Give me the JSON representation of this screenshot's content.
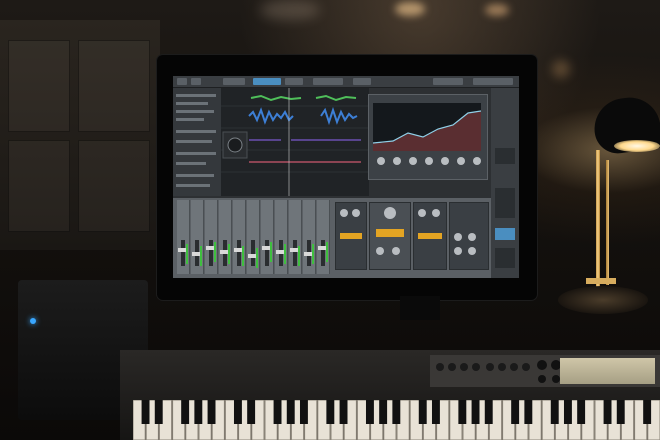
{
  "scene": {
    "description_tag": "studio-desk",
    "colors": {
      "wall": "#14110e",
      "lamp_light": "#ffd98c",
      "screen_bg": "#2d3033",
      "waveform_blue": "#3d7fd6",
      "waveform_green": "#4fbf5a",
      "power_led": "#39a7ff"
    }
  },
  "icons": [
    "power-led",
    "lamp",
    "keyboard",
    "monitor",
    "speaker"
  ]
}
